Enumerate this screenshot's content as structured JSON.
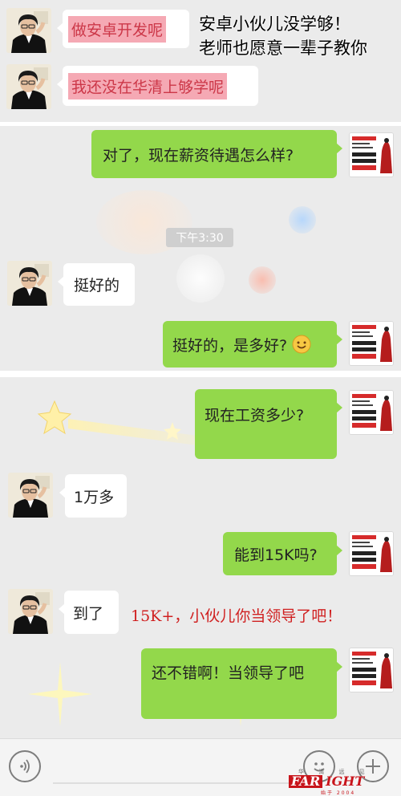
{
  "captions": {
    "top_line1": "安卓小伙儿没学够！",
    "top_line2": "老师也愿意一辈子教你",
    "middle": "15K+，小伙儿你当领导了吧！"
  },
  "panel1": {
    "messages": [
      {
        "side": "left",
        "text": "做安卓开发呢"
      },
      {
        "side": "left",
        "text": "我还没在华清上够学呢"
      }
    ]
  },
  "panel2": {
    "messages": [
      {
        "side": "right",
        "text": "对了，现在薪资待遇怎么样?"
      },
      {
        "side": "left",
        "text": "挺好的"
      },
      {
        "side": "right",
        "text": "挺好的，是多好?"
      }
    ],
    "timestamp": "下午3:30"
  },
  "panel3": {
    "messages": [
      {
        "side": "right",
        "text": "现在工资多少?"
      },
      {
        "side": "left",
        "text": "1万多"
      },
      {
        "side": "right",
        "text": "能到15K吗?"
      },
      {
        "side": "left",
        "text": "到了"
      },
      {
        "side": "right",
        "text": "还不错啊！当领导了吧"
      }
    ]
  },
  "avatar_right": {
    "line1": "你想做怎样的人",
    "line2": "最终做成一个怎样的人",
    "line3": "取决于你的自己"
  },
  "watermark": {
    "brand_left": "FAR",
    "brand_right": "IGHT",
    "top_chars": "华 清 远 见",
    "sub": "始于 2004"
  },
  "colors": {
    "panel_bg": "#ebebeb",
    "green_bubble": "#93d84b",
    "white_bubble": "#ffffff",
    "highlight_pink": "#f5a9b4",
    "caption_red": "#d02020"
  },
  "input_bar": {
    "voice_icon": "voice-icon",
    "emoji_icon": "smiley-icon",
    "plus_icon": "plus-icon"
  }
}
